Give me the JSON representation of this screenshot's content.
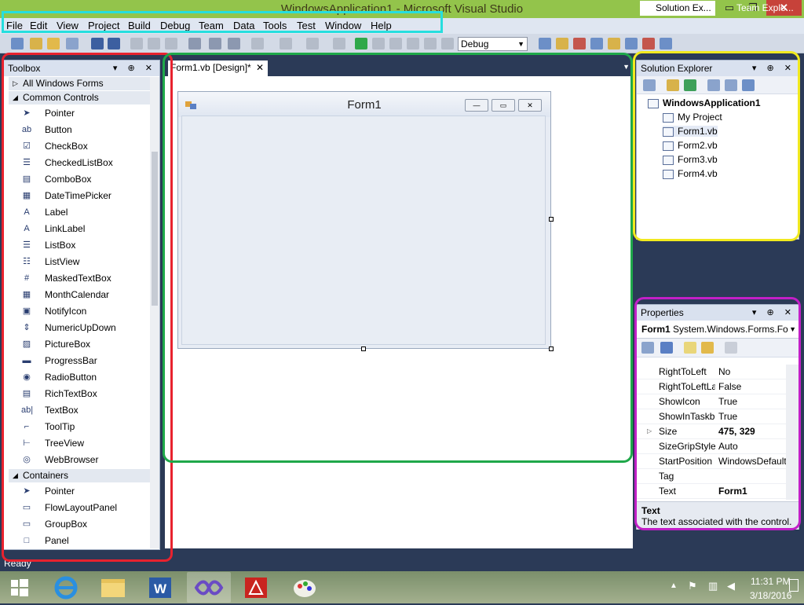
{
  "window": {
    "title": "WindowsApplication1 - Microsoft Visual Studio",
    "min": "▭",
    "max": "❐",
    "close": "✕"
  },
  "menu": [
    "File",
    "Edit",
    "View",
    "Project",
    "Build",
    "Debug",
    "Team",
    "Data",
    "Tools",
    "Test",
    "Window",
    "Help"
  ],
  "toolbar": {
    "config": "Debug"
  },
  "toolbox": {
    "title": "Toolbox",
    "pin": "▾ ⊕ ✕",
    "all_forms": "All Windows Forms",
    "common_controls": "Common Controls",
    "items": [
      {
        "label": "Pointer",
        "icon": "pointer-icon",
        "glyph": "➤"
      },
      {
        "label": "Button",
        "icon": "button-icon",
        "glyph": "ab"
      },
      {
        "label": "CheckBox",
        "icon": "checkbox-icon",
        "glyph": "☑"
      },
      {
        "label": "CheckedListBox",
        "icon": "checkedlistbox-icon",
        "glyph": "☰"
      },
      {
        "label": "ComboBox",
        "icon": "combobox-icon",
        "glyph": "▤"
      },
      {
        "label": "DateTimePicker",
        "icon": "datetimepicker-icon",
        "glyph": "▦"
      },
      {
        "label": "Label",
        "icon": "label-icon",
        "glyph": "A"
      },
      {
        "label": "LinkLabel",
        "icon": "linklabel-icon",
        "glyph": "A"
      },
      {
        "label": "ListBox",
        "icon": "listbox-icon",
        "glyph": "☰"
      },
      {
        "label": "ListView",
        "icon": "listview-icon",
        "glyph": "☷"
      },
      {
        "label": "MaskedTextBox",
        "icon": "maskedtextbox-icon",
        "glyph": "#"
      },
      {
        "label": "MonthCalendar",
        "icon": "monthcalendar-icon",
        "glyph": "▦"
      },
      {
        "label": "NotifyIcon",
        "icon": "notifyicon-icon",
        "glyph": "▣"
      },
      {
        "label": "NumericUpDown",
        "icon": "numericupdown-icon",
        "glyph": "⇕"
      },
      {
        "label": "PictureBox",
        "icon": "picturebox-icon",
        "glyph": "▨"
      },
      {
        "label": "ProgressBar",
        "icon": "progressbar-icon",
        "glyph": "▬"
      },
      {
        "label": "RadioButton",
        "icon": "radiobutton-icon",
        "glyph": "◉"
      },
      {
        "label": "RichTextBox",
        "icon": "richtextbox-icon",
        "glyph": "▤"
      },
      {
        "label": "TextBox",
        "icon": "textbox-icon",
        "glyph": "ab|"
      },
      {
        "label": "ToolTip",
        "icon": "tooltip-icon",
        "glyph": "⌐"
      },
      {
        "label": "TreeView",
        "icon": "treeview-icon",
        "glyph": "⊢"
      },
      {
        "label": "WebBrowser",
        "icon": "webbrowser-icon",
        "glyph": "◎"
      }
    ],
    "containers": "Containers",
    "container_items": [
      {
        "label": "Pointer",
        "icon": "pointer-icon",
        "glyph": "➤"
      },
      {
        "label": "FlowLayoutPanel",
        "icon": "flowlayoutpanel-icon",
        "glyph": "▭"
      },
      {
        "label": "GroupBox",
        "icon": "groupbox-icon",
        "glyph": "▭"
      },
      {
        "label": "Panel",
        "icon": "panel-icon",
        "glyph": "□"
      }
    ]
  },
  "editor": {
    "tab": "Form1.vb [Design]*",
    "tab_close": "✕",
    "form_title": "Form1"
  },
  "solution": {
    "title": "Solution Explorer",
    "root": "WindowsApplication1",
    "items": [
      "My Project",
      "Form1.vb",
      "Form2.vb",
      "Form3.vb",
      "Form4.vb"
    ],
    "tabs": [
      "Solution Ex...",
      "Team Explo..."
    ]
  },
  "properties": {
    "title": "Properties",
    "object": "Form1",
    "object_type": "System.Windows.Forms.Fo",
    "rows": [
      {
        "name": "RightToLeft",
        "value": "No",
        "bold": false,
        "expand": ""
      },
      {
        "name": "RightToLeftLa",
        "value": "False",
        "bold": false,
        "expand": ""
      },
      {
        "name": "ShowIcon",
        "value": "True",
        "bold": false,
        "expand": ""
      },
      {
        "name": "ShowInTaskb",
        "value": "True",
        "bold": false,
        "expand": ""
      },
      {
        "name": "Size",
        "value": "475, 329",
        "bold": true,
        "expand": "▷"
      },
      {
        "name": "SizeGripStyle",
        "value": "Auto",
        "bold": false,
        "expand": ""
      },
      {
        "name": "StartPosition",
        "value": "WindowsDefault",
        "bold": false,
        "expand": ""
      },
      {
        "name": "Tag",
        "value": "",
        "bold": false,
        "expand": ""
      },
      {
        "name": "Text",
        "value": "Form1",
        "bold": true,
        "expand": ""
      }
    ],
    "desc_title": "Text",
    "desc_body": "The text associated with the control."
  },
  "status": "Ready",
  "taskbar": {
    "time": "11:31 PM",
    "date": "3/18/2016",
    "apps": [
      "windows-start-icon",
      "internet-explorer-icon",
      "file-explorer-icon",
      "word-icon",
      "visual-studio-icon",
      "acrobat-icon",
      "paint-icon"
    ]
  },
  "colors": {
    "titlebar": "#93c44b",
    "workspace": "#2b3a57",
    "annot_cyan": "#26dede",
    "annot_red": "#e8222e",
    "annot_green": "#1fa84a",
    "annot_yellow": "#f1e91f",
    "annot_magenta": "#c21fc7"
  }
}
